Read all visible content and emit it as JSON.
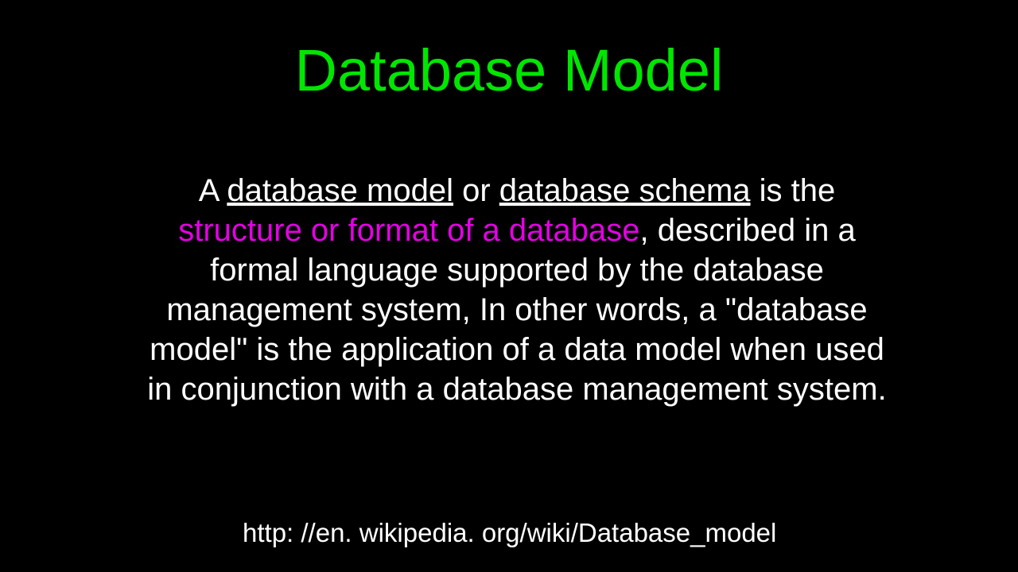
{
  "title": "Database Model",
  "body": {
    "p1": "A ",
    "p2": "database model",
    "p3": " or ",
    "p4": "database schema",
    "p5": " is the ",
    "p6": "structure or format of a database",
    "p7": ", described in a formal language supported by the database management system, In other words, a \"database model\" is the application of a data model when used in conjunction with a database management system."
  },
  "footer": "http: //en. wikipedia. org/wiki/Database_model"
}
